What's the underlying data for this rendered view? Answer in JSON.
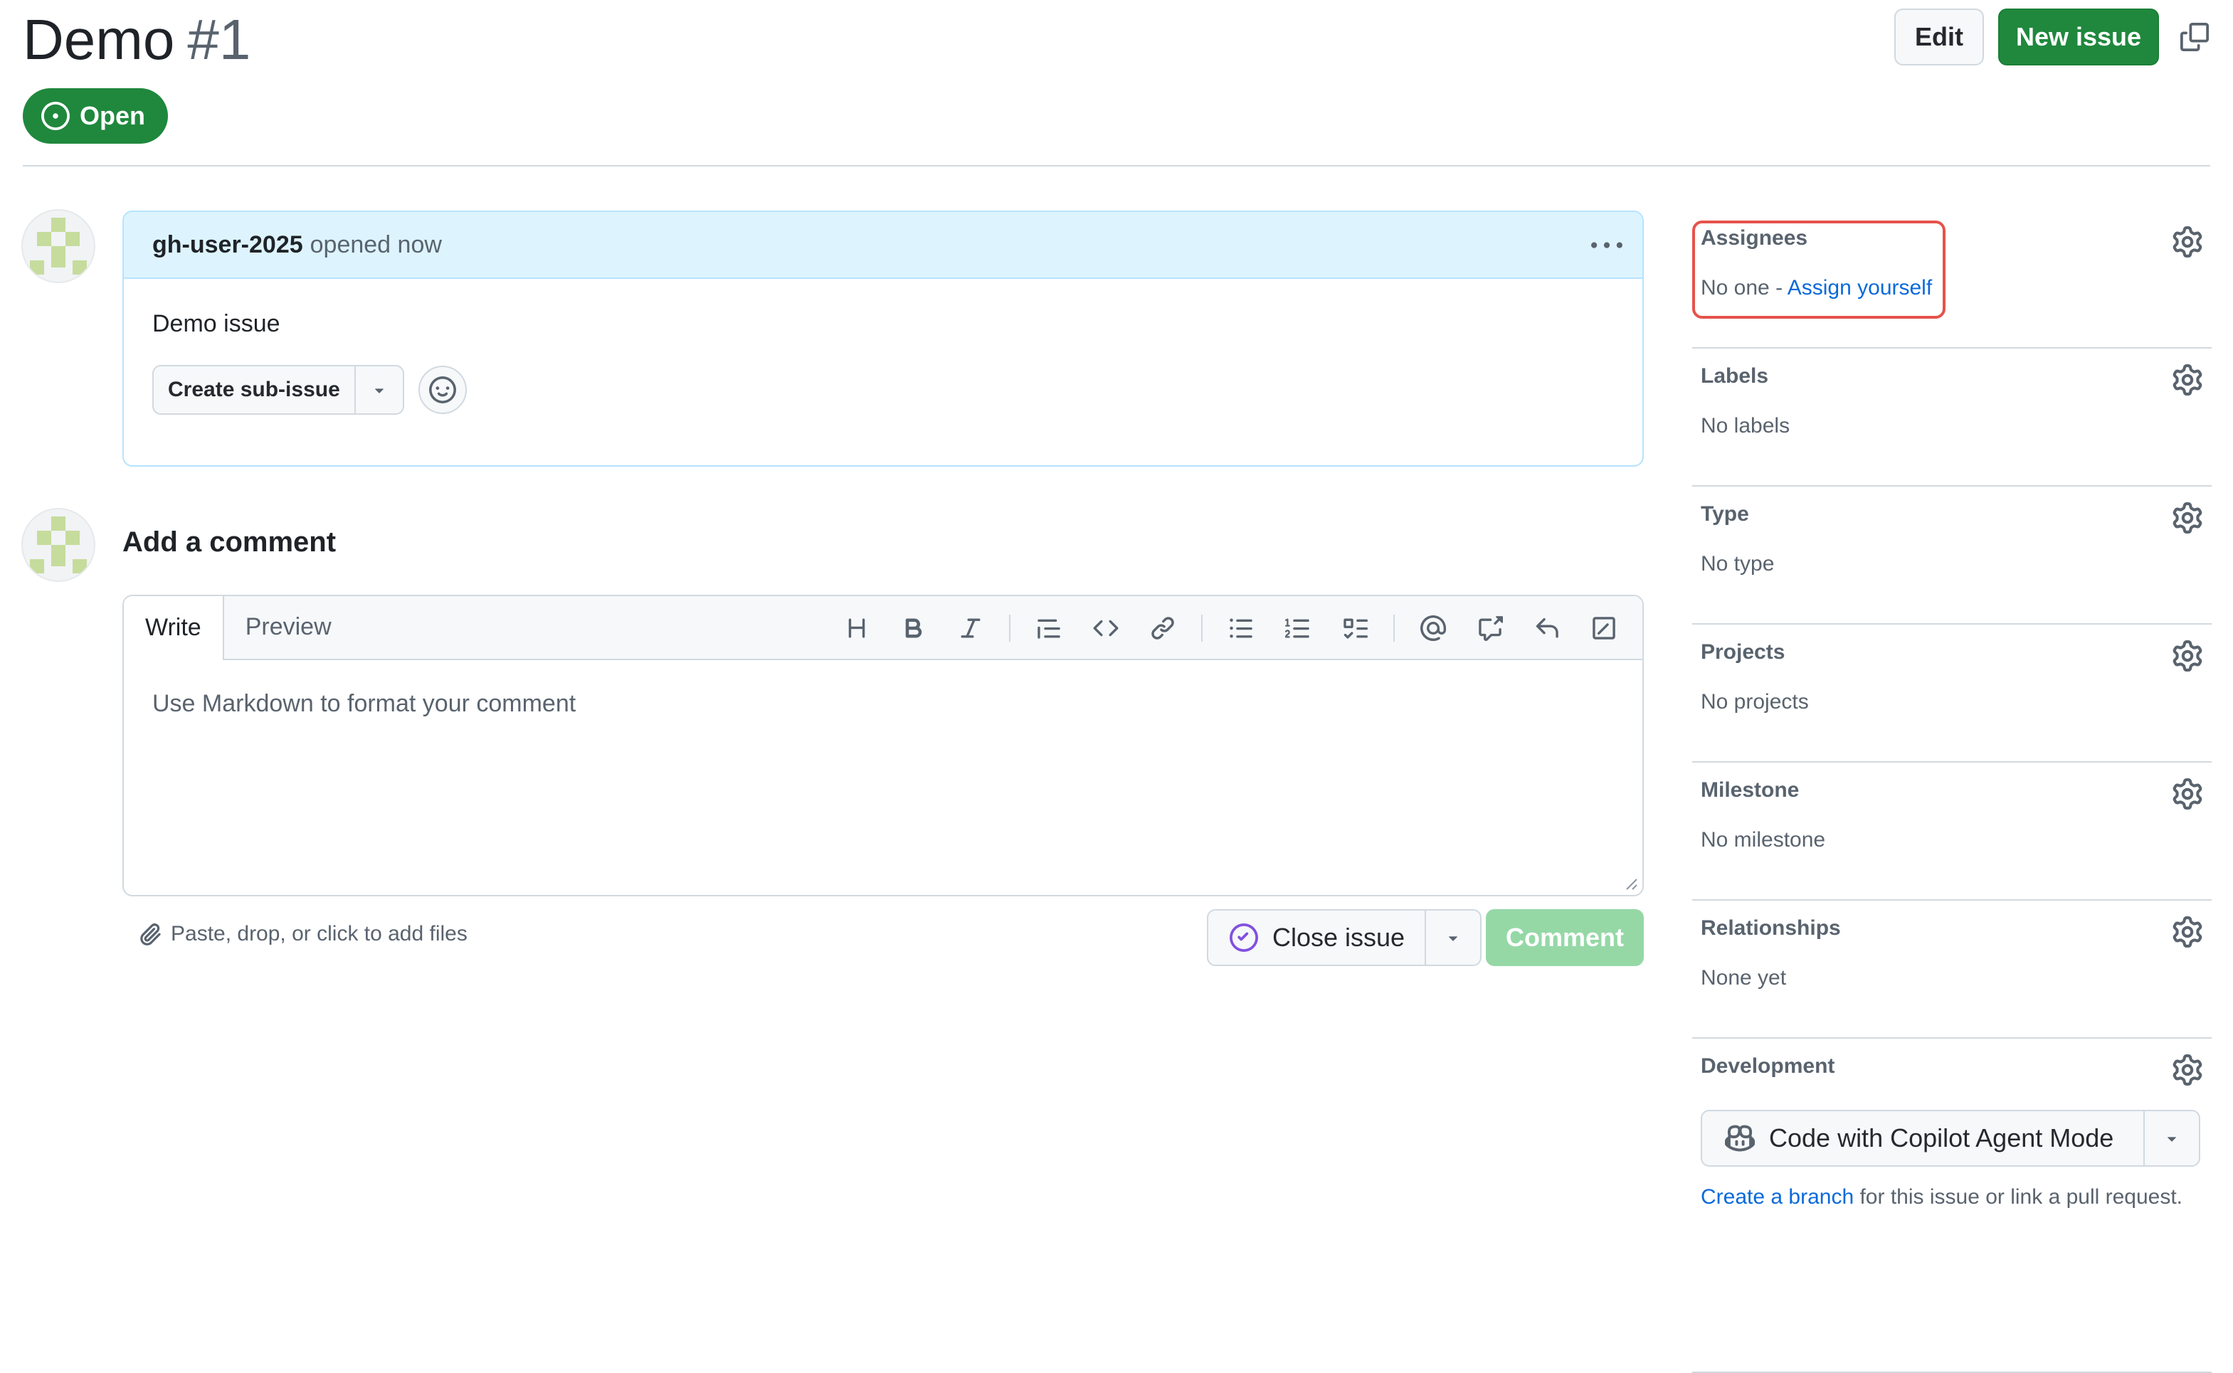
{
  "header": {
    "title": "Demo",
    "number": "#1",
    "state": "Open",
    "edit_label": "Edit",
    "new_issue_label": "New issue"
  },
  "issue": {
    "author": "gh-user-2025",
    "meta": "opened now",
    "body": "Demo issue",
    "create_sub_issue_label": "Create sub-issue"
  },
  "composer": {
    "heading": "Add a comment",
    "tabs": [
      "Write",
      "Preview"
    ],
    "placeholder": "Use Markdown to format your comment",
    "attach_hint": "Paste, drop, or click to add files",
    "close_issue_label": "Close issue",
    "comment_label": "Comment"
  },
  "sidebar": {
    "assignees": {
      "title": "Assignees",
      "value_prefix": "No one - ",
      "assign_link": "Assign yourself"
    },
    "labels": {
      "title": "Labels",
      "value": "No labels"
    },
    "type": {
      "title": "Type",
      "value": "No type"
    },
    "projects": {
      "title": "Projects",
      "value": "No projects"
    },
    "milestone": {
      "title": "Milestone",
      "value": "No milestone"
    },
    "relationships": {
      "title": "Relationships",
      "value": "None yet"
    },
    "development": {
      "title": "Development",
      "copilot_label": "Code with Copilot Agent Mode",
      "branch_link": "Create a branch",
      "branch_suffix": " for this issue or link a pull request."
    }
  },
  "colors": {
    "open_green": "#1f883d",
    "link_blue": "#0969da",
    "comment_header_bg": "#ddf4ff",
    "highlight_red": "#e5534b",
    "comment_disabled_green": "#95d8a6"
  }
}
